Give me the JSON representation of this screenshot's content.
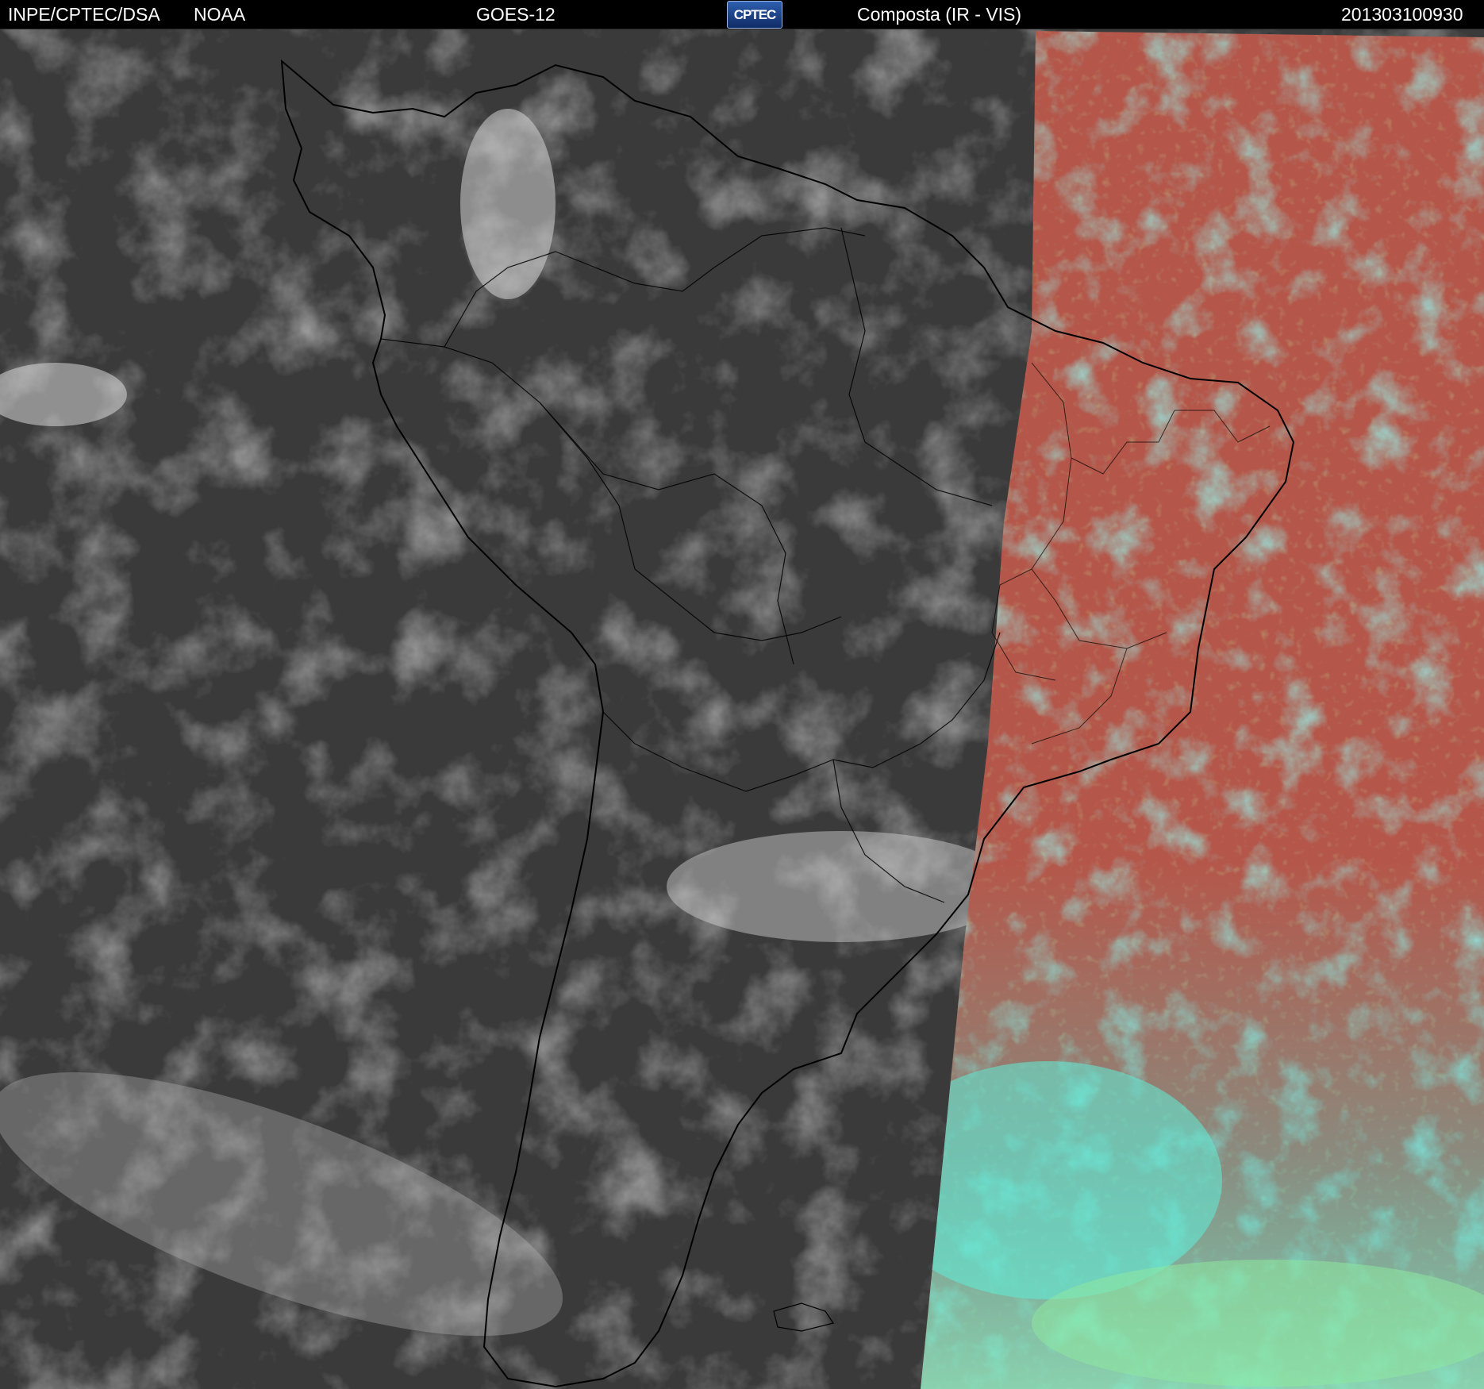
{
  "header": {
    "agency": "INPE/CPTEC/DSA",
    "partner": "NOAA",
    "satellite": "GOES-12",
    "logo_text": "CPTEC",
    "product": "Composta (IR - VIS)",
    "timestamp": "201303100930"
  },
  "map": {
    "region": "South America",
    "ir_panel_color": "#3a3a3a",
    "vis_panel_colors": [
      "#b4574a",
      "#3ee8dc",
      "#8bd85e"
    ],
    "coastline_color": "#000000",
    "icons": [
      "cptec-logo-icon"
    ]
  }
}
